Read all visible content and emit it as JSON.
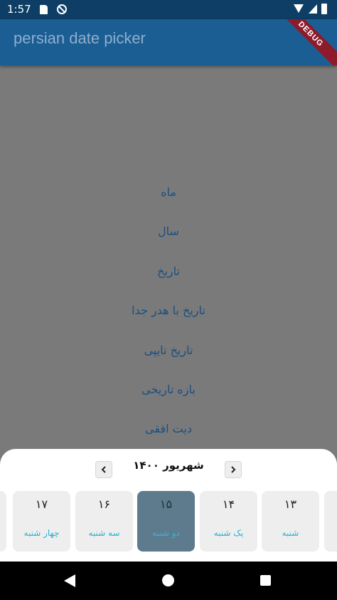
{
  "status": {
    "time": "1:57"
  },
  "app": {
    "title": "persian date picker",
    "debug_label": "DEBUG"
  },
  "menu": [
    {
      "label": "ماه"
    },
    {
      "label": "سال"
    },
    {
      "label": "تاریخ"
    },
    {
      "label": "تاریخ با هدر جدا"
    },
    {
      "label": "تاریخ تایپی"
    },
    {
      "label": "بازه تاریخی"
    },
    {
      "label": "دیت افقی"
    }
  ],
  "picker": {
    "month_label": "شهریور ۱۴۰۰",
    "days": [
      {
        "num": "۱۷",
        "name": "چهار شنبه"
      },
      {
        "num": "۱۶",
        "name": "سه شنبه"
      },
      {
        "num": "۱۵",
        "name": "دو شنبه",
        "selected": true
      },
      {
        "num": "۱۴",
        "name": "یک شنبه"
      },
      {
        "num": "۱۳",
        "name": "شنبه"
      }
    ]
  },
  "colors": {
    "app_bar": "#1b5e94",
    "status_bar": "#0e3e66",
    "selected_day": "#5e7b8d",
    "day_name": "#25b3d6",
    "menu_text": "#1a4f80"
  }
}
